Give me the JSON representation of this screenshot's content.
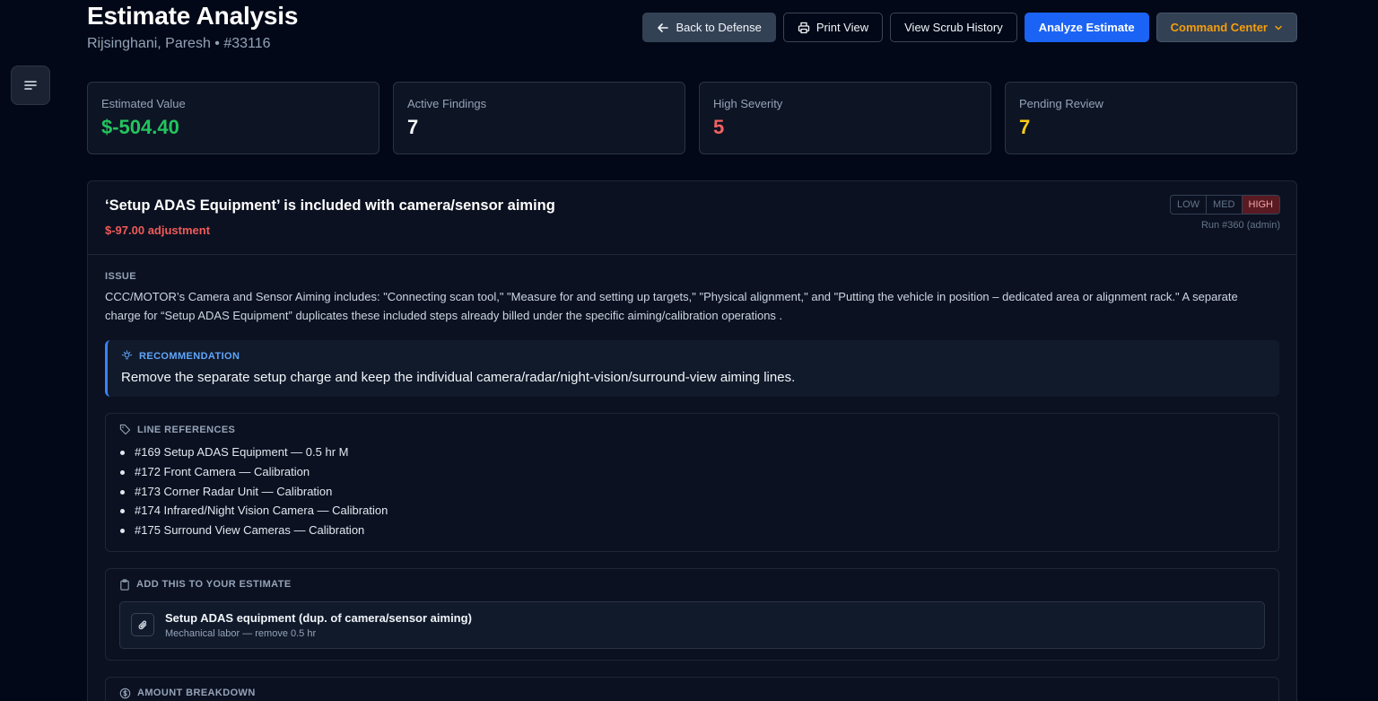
{
  "header": {
    "title": "Estimate Analysis",
    "subtitle": "Rijsinghani, Paresh • #33116"
  },
  "toolbar": {
    "back_label": "Back to Defense",
    "print_label": "Print View",
    "history_label": "View Scrub History",
    "analyze_label": "Analyze Estimate",
    "command_label": "Command Center"
  },
  "stats": [
    {
      "label": "Estimated Value",
      "value": "$-504.40",
      "color": "#22c55e"
    },
    {
      "label": "Active Findings",
      "value": "7",
      "color": "#f8fafc"
    },
    {
      "label": "High Severity",
      "value": "5",
      "color": "#f16161"
    },
    {
      "label": "Pending Review",
      "value": "7",
      "color": "#facc15"
    }
  ],
  "finding": {
    "title": "‘Setup ADAS Equipment’ is included with camera/sensor aiming",
    "adjustment": "$-97.00 adjustment",
    "severity_options": [
      "LOW",
      "MED",
      "HIGH"
    ],
    "severity_selected": "HIGH",
    "run_label": "Run #360 (admin)",
    "issue_label": "ISSUE",
    "issue_text": "CCC/MOTOR’s Camera and Sensor Aiming includes: \"Connecting scan tool,\" \"Measure for and setting up targets,\" \"Physical alignment,\" and \"Putting the vehicle in position – dedicated area or alignment rack.\" A separate charge for “Setup ADAS Equipment” duplicates these included steps already billed under the specific aiming/calibration operations .",
    "recommendation_label": "RECOMMENDATION",
    "recommendation_text": "Remove the separate setup charge and keep the individual camera/radar/night-vision/surround-view aiming lines.",
    "line_refs_label": "LINE REFERENCES",
    "line_refs": [
      "#169 Setup ADAS Equipment — 0.5 hr M",
      "#172 Front Camera — Calibration",
      "#173 Corner Radar Unit — Calibration",
      "#174 Infrared/Night Vision Camera — Calibration",
      "#175 Surround View Cameras — Calibration"
    ],
    "add_label": "ADD THIS TO YOUR ESTIMATE",
    "add_item": {
      "title": "Setup ADAS equipment (dup. of camera/sensor aiming)",
      "subtitle": "Mechanical labor — remove 0.5 hr"
    },
    "amount_label": "AMOUNT BREAKDOWN"
  }
}
